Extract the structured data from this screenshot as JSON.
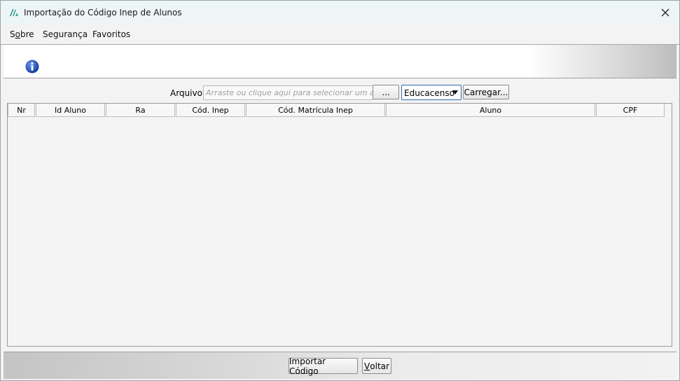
{
  "window": {
    "title": "Importação do Código Inep de Alunos"
  },
  "menu": {
    "items": [
      {
        "prefix": "S",
        "underline": "o",
        "suffix": "bre"
      },
      {
        "label": "Segurança"
      },
      {
        "label": "Favoritos"
      }
    ]
  },
  "file_row": {
    "label": "Arquivo:",
    "placeholder": "Arraste ou clique aqui para selecionar um arq",
    "browse_label": "...",
    "select_value": "Educacenso",
    "load_label": "Carregar..."
  },
  "table": {
    "columns": [
      "Nr",
      "Id Aluno",
      "Ra",
      "Cód. Inep",
      "Cód. Matrícula Inep",
      "Aluno",
      "CPF"
    ],
    "rows": []
  },
  "footer": {
    "import_label": "Importar Código",
    "back_prefix": "",
    "back_underline": "V",
    "back_suffix": "oltar"
  },
  "colors": {
    "accent": "#2b6cb0",
    "app_icon": "#1f8a8a",
    "info_icon": "#1e4fb5"
  }
}
